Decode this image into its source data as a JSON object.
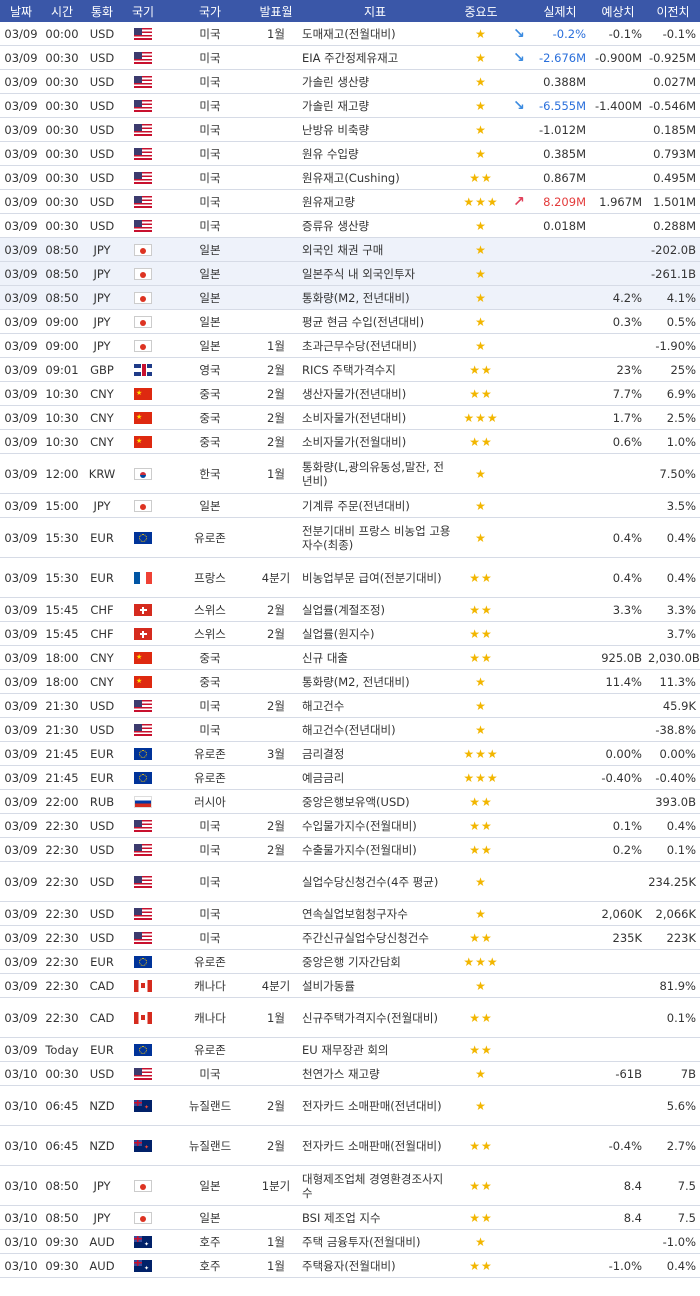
{
  "headers": [
    "날짜",
    "시간",
    "통화",
    "국기",
    "국가",
    "발표월",
    "지표",
    "중요도",
    "",
    "실제치",
    "예상치",
    "이전치"
  ],
  "colors": {
    "header_bg": "#3a57a8",
    "star": "#f2b600",
    "arrow_down": "#3b8be0",
    "arrow_up": "#e0405a",
    "actual_negative": "#2a6fdb",
    "actual_positive": "#e33b3b"
  },
  "rows": [
    {
      "date": "03/09",
      "time": "00:00",
      "cur": "USD",
      "flag": "us",
      "country": "미국",
      "month": "1월",
      "indicator": "도매재고(전월대비)",
      "stars": "★",
      "arrow": "down",
      "actual": "-0.2%",
      "actual_color": "blue",
      "forecast": "-0.1%",
      "previous": "-0.1%"
    },
    {
      "date": "03/09",
      "time": "00:30",
      "cur": "USD",
      "flag": "us",
      "country": "미국",
      "month": "",
      "indicator": "EIA 주간정제유재고",
      "stars": "★",
      "arrow": "down",
      "actual": "-2.676M",
      "actual_color": "blue",
      "forecast": "-0.900M",
      "previous": "-0.925M"
    },
    {
      "date": "03/09",
      "time": "00:30",
      "cur": "USD",
      "flag": "us",
      "country": "미국",
      "month": "",
      "indicator": "가솔린 생산량",
      "stars": "★",
      "arrow": "",
      "actual": "0.388M",
      "actual_color": "",
      "forecast": "",
      "previous": "0.027M"
    },
    {
      "date": "03/09",
      "time": "00:30",
      "cur": "USD",
      "flag": "us",
      "country": "미국",
      "month": "",
      "indicator": "가솔린 재고량",
      "stars": "★",
      "arrow": "down",
      "actual": "-6.555M",
      "actual_color": "blue",
      "forecast": "-1.400M",
      "previous": "-0.546M"
    },
    {
      "date": "03/09",
      "time": "00:30",
      "cur": "USD",
      "flag": "us",
      "country": "미국",
      "month": "",
      "indicator": "난방유 비축량",
      "stars": "★",
      "arrow": "",
      "actual": "-1.012M",
      "actual_color": "",
      "forecast": "",
      "previous": "0.185M"
    },
    {
      "date": "03/09",
      "time": "00:30",
      "cur": "USD",
      "flag": "us",
      "country": "미국",
      "month": "",
      "indicator": "원유 수입량",
      "stars": "★",
      "arrow": "",
      "actual": "0.385M",
      "actual_color": "",
      "forecast": "",
      "previous": "0.793M"
    },
    {
      "date": "03/09",
      "time": "00:30",
      "cur": "USD",
      "flag": "us",
      "country": "미국",
      "month": "",
      "indicator": "원유재고(Cushing)",
      "stars": "★★",
      "arrow": "",
      "actual": "0.867M",
      "actual_color": "",
      "forecast": "",
      "previous": "0.495M"
    },
    {
      "date": "03/09",
      "time": "00:30",
      "cur": "USD",
      "flag": "us",
      "country": "미국",
      "month": "",
      "indicator": "원유재고량",
      "stars": "★★★",
      "arrow": "up",
      "actual": "8.209M",
      "actual_color": "red",
      "forecast": "1.967M",
      "previous": "1.501M"
    },
    {
      "date": "03/09",
      "time": "00:30",
      "cur": "USD",
      "flag": "us",
      "country": "미국",
      "month": "",
      "indicator": "증류유 생산량",
      "stars": "★",
      "arrow": "",
      "actual": "0.018M",
      "actual_color": "",
      "forecast": "",
      "previous": "0.288M"
    },
    {
      "date": "03/09",
      "time": "08:50",
      "cur": "JPY",
      "flag": "jp",
      "country": "일본",
      "month": "",
      "indicator": "외국인 채권 구매",
      "stars": "★",
      "arrow": "",
      "actual": "",
      "actual_color": "",
      "forecast": "",
      "previous": "-202.0B",
      "hl": true
    },
    {
      "date": "03/09",
      "time": "08:50",
      "cur": "JPY",
      "flag": "jp",
      "country": "일본",
      "month": "",
      "indicator": "일본주식 내 외국인투자",
      "stars": "★",
      "arrow": "",
      "actual": "",
      "actual_color": "",
      "forecast": "",
      "previous": "-261.1B",
      "hl": true
    },
    {
      "date": "03/09",
      "time": "08:50",
      "cur": "JPY",
      "flag": "jp",
      "country": "일본",
      "month": "",
      "indicator": "통화량(M2, 전년대비)",
      "stars": "★",
      "arrow": "",
      "actual": "",
      "actual_color": "",
      "forecast": "4.2%",
      "previous": "4.1%",
      "hl": true
    },
    {
      "date": "03/09",
      "time": "09:00",
      "cur": "JPY",
      "flag": "jp",
      "country": "일본",
      "month": "",
      "indicator": "평균 현금 수입(전년대비)",
      "stars": "★",
      "arrow": "",
      "actual": "",
      "actual_color": "",
      "forecast": "0.3%",
      "previous": "0.5%"
    },
    {
      "date": "03/09",
      "time": "09:00",
      "cur": "JPY",
      "flag": "jp",
      "country": "일본",
      "month": "1월",
      "indicator": "초과근무수당(전년대비)",
      "stars": "★",
      "arrow": "",
      "actual": "",
      "actual_color": "",
      "forecast": "",
      "previous": "-1.90%"
    },
    {
      "date": "03/09",
      "time": "09:01",
      "cur": "GBP",
      "flag": "gb",
      "country": "영국",
      "month": "2월",
      "indicator": "RICS 주택가격수지",
      "stars": "★★",
      "arrow": "",
      "actual": "",
      "actual_color": "",
      "forecast": "23%",
      "previous": "25%"
    },
    {
      "date": "03/09",
      "time": "10:30",
      "cur": "CNY",
      "flag": "cn",
      "country": "중국",
      "month": "2월",
      "indicator": "생산자물가(전년대비)",
      "stars": "★★",
      "arrow": "",
      "actual": "",
      "actual_color": "",
      "forecast": "7.7%",
      "previous": "6.9%"
    },
    {
      "date": "03/09",
      "time": "10:30",
      "cur": "CNY",
      "flag": "cn",
      "country": "중국",
      "month": "2월",
      "indicator": "소비자물가(전년대비)",
      "stars": "★★★",
      "arrow": "",
      "actual": "",
      "actual_color": "",
      "forecast": "1.7%",
      "previous": "2.5%"
    },
    {
      "date": "03/09",
      "time": "10:30",
      "cur": "CNY",
      "flag": "cn",
      "country": "중국",
      "month": "2월",
      "indicator": "소비자물가(전월대비)",
      "stars": "★★",
      "arrow": "",
      "actual": "",
      "actual_color": "",
      "forecast": "0.6%",
      "previous": "1.0%"
    },
    {
      "date": "03/09",
      "time": "12:00",
      "cur": "KRW",
      "flag": "kr",
      "country": "한국",
      "month": "1월",
      "indicator": "통화량(L,광의유동성,말잔, 전년비)",
      "stars": "★",
      "arrow": "",
      "actual": "",
      "actual_color": "",
      "forecast": "",
      "previous": "7.50%",
      "tall": true
    },
    {
      "date": "03/09",
      "time": "15:00",
      "cur": "JPY",
      "flag": "jp",
      "country": "일본",
      "month": "",
      "indicator": "기계류 주문(전년대비)",
      "stars": "★",
      "arrow": "",
      "actual": "",
      "actual_color": "",
      "forecast": "",
      "previous": "3.5%"
    },
    {
      "date": "03/09",
      "time": "15:30",
      "cur": "EUR",
      "flag": "eu",
      "country": "유로존",
      "month": "",
      "indicator": "전분기대비 프랑스 비농업 고용자수(최종)",
      "stars": "★",
      "arrow": "",
      "actual": "",
      "actual_color": "",
      "forecast": "0.4%",
      "previous": "0.4%",
      "tall": true
    },
    {
      "date": "03/09",
      "time": "15:30",
      "cur": "EUR",
      "flag": "fr",
      "country": "프랑스",
      "month": "4분기",
      "indicator": "비농업부문 급여(전분기대비)",
      "stars": "★★",
      "arrow": "",
      "actual": "",
      "actual_color": "",
      "forecast": "0.4%",
      "previous": "0.4%",
      "tall": true
    },
    {
      "date": "03/09",
      "time": "15:45",
      "cur": "CHF",
      "flag": "ch",
      "country": "스위스",
      "month": "2월",
      "indicator": "실업률(계절조정)",
      "stars": "★★",
      "arrow": "",
      "actual": "",
      "actual_color": "",
      "forecast": "3.3%",
      "previous": "3.3%"
    },
    {
      "date": "03/09",
      "time": "15:45",
      "cur": "CHF",
      "flag": "ch",
      "country": "스위스",
      "month": "2월",
      "indicator": "실업률(원지수)",
      "stars": "★★",
      "arrow": "",
      "actual": "",
      "actual_color": "",
      "forecast": "",
      "previous": "3.7%"
    },
    {
      "date": "03/09",
      "time": "18:00",
      "cur": "CNY",
      "flag": "cn",
      "country": "중국",
      "month": "",
      "indicator": "신규 대출",
      "stars": "★★",
      "arrow": "",
      "actual": "",
      "actual_color": "",
      "forecast": "925.0B",
      "previous": "2,030.0B"
    },
    {
      "date": "03/09",
      "time": "18:00",
      "cur": "CNY",
      "flag": "cn",
      "country": "중국",
      "month": "",
      "indicator": "통화량(M2, 전년대비)",
      "stars": "★",
      "arrow": "",
      "actual": "",
      "actual_color": "",
      "forecast": "11.4%",
      "previous": "11.3%"
    },
    {
      "date": "03/09",
      "time": "21:30",
      "cur": "USD",
      "flag": "us",
      "country": "미국",
      "month": "2월",
      "indicator": "해고건수",
      "stars": "★",
      "arrow": "",
      "actual": "",
      "actual_color": "",
      "forecast": "",
      "previous": "45.9K"
    },
    {
      "date": "03/09",
      "time": "21:30",
      "cur": "USD",
      "flag": "us",
      "country": "미국",
      "month": "",
      "indicator": "해고건수(전년대비)",
      "stars": "★",
      "arrow": "",
      "actual": "",
      "actual_color": "",
      "forecast": "",
      "previous": "-38.8%"
    },
    {
      "date": "03/09",
      "time": "21:45",
      "cur": "EUR",
      "flag": "eu",
      "country": "유로존",
      "month": "3월",
      "indicator": "금리결정",
      "stars": "★★★",
      "arrow": "",
      "actual": "",
      "actual_color": "",
      "forecast": "0.00%",
      "previous": "0.00%"
    },
    {
      "date": "03/09",
      "time": "21:45",
      "cur": "EUR",
      "flag": "eu",
      "country": "유로존",
      "month": "",
      "indicator": "예금금리",
      "stars": "★★★",
      "arrow": "",
      "actual": "",
      "actual_color": "",
      "forecast": "-0.40%",
      "previous": "-0.40%"
    },
    {
      "date": "03/09",
      "time": "22:00",
      "cur": "RUB",
      "flag": "ru",
      "country": "러시아",
      "month": "",
      "indicator": "중앙은행보유액(USD)",
      "stars": "★★",
      "arrow": "",
      "actual": "",
      "actual_color": "",
      "forecast": "",
      "previous": "393.0B"
    },
    {
      "date": "03/09",
      "time": "22:30",
      "cur": "USD",
      "flag": "us",
      "country": "미국",
      "month": "2월",
      "indicator": "수입물가지수(전월대비)",
      "stars": "★★",
      "arrow": "",
      "actual": "",
      "actual_color": "",
      "forecast": "0.1%",
      "previous": "0.4%"
    },
    {
      "date": "03/09",
      "time": "22:30",
      "cur": "USD",
      "flag": "us",
      "country": "미국",
      "month": "2월",
      "indicator": "수출물가지수(전월대비)",
      "stars": "★★",
      "arrow": "",
      "actual": "",
      "actual_color": "",
      "forecast": "0.2%",
      "previous": "0.1%"
    },
    {
      "date": "03/09",
      "time": "22:30",
      "cur": "USD",
      "flag": "us",
      "country": "미국",
      "month": "",
      "indicator": "실업수당신청건수(4주 평균)",
      "stars": "★",
      "arrow": "",
      "actual": "",
      "actual_color": "",
      "forecast": "",
      "previous": "234.25K",
      "tall": true
    },
    {
      "date": "03/09",
      "time": "22:30",
      "cur": "USD",
      "flag": "us",
      "country": "미국",
      "month": "",
      "indicator": "연속실업보험청구자수",
      "stars": "★",
      "arrow": "",
      "actual": "",
      "actual_color": "",
      "forecast": "2,060K",
      "previous": "2,066K"
    },
    {
      "date": "03/09",
      "time": "22:30",
      "cur": "USD",
      "flag": "us",
      "country": "미국",
      "month": "",
      "indicator": "주간신규실업수당신청건수",
      "stars": "★★",
      "arrow": "",
      "actual": "",
      "actual_color": "",
      "forecast": "235K",
      "previous": "223K"
    },
    {
      "date": "03/09",
      "time": "22:30",
      "cur": "EUR",
      "flag": "eu",
      "country": "유로존",
      "month": "",
      "indicator": "중앙은행 기자간담회",
      "stars": "★★★",
      "arrow": "",
      "actual": "",
      "actual_color": "",
      "forecast": "",
      "previous": ""
    },
    {
      "date": "03/09",
      "time": "22:30",
      "cur": "CAD",
      "flag": "ca",
      "country": "캐나다",
      "month": "4분기",
      "indicator": "설비가동률",
      "stars": "★",
      "arrow": "",
      "actual": "",
      "actual_color": "",
      "forecast": "",
      "previous": "81.9%"
    },
    {
      "date": "03/09",
      "time": "22:30",
      "cur": "CAD",
      "flag": "ca",
      "country": "캐나다",
      "month": "1월",
      "indicator": "신규주택가격지수(전월대비)",
      "stars": "★★",
      "arrow": "",
      "actual": "",
      "actual_color": "",
      "forecast": "",
      "previous": "0.1%",
      "tall": true
    },
    {
      "date": "03/09",
      "time": "Today",
      "cur": "EUR",
      "flag": "eu",
      "country": "유로존",
      "month": "",
      "indicator": "EU 재무장관 회의",
      "stars": "★★",
      "arrow": "",
      "actual": "",
      "actual_color": "",
      "forecast": "",
      "previous": ""
    },
    {
      "date": "03/10",
      "time": "00:30",
      "cur": "USD",
      "flag": "us",
      "country": "미국",
      "month": "",
      "indicator": "천연가스 재고량",
      "stars": "★",
      "arrow": "",
      "actual": "",
      "actual_color": "",
      "forecast": "-61B",
      "previous": "7B"
    },
    {
      "date": "03/10",
      "time": "06:45",
      "cur": "NZD",
      "flag": "nz",
      "country": "뉴질랜드",
      "month": "2월",
      "indicator": "전자카드 소매판매(전년대비)",
      "stars": "★",
      "arrow": "",
      "actual": "",
      "actual_color": "",
      "forecast": "",
      "previous": "5.6%",
      "tall": true
    },
    {
      "date": "03/10",
      "time": "06:45",
      "cur": "NZD",
      "flag": "nz",
      "country": "뉴질랜드",
      "month": "2월",
      "indicator": "전자카드 소매판매(전월대비)",
      "stars": "★★",
      "arrow": "",
      "actual": "",
      "actual_color": "",
      "forecast": "-0.4%",
      "previous": "2.7%",
      "tall": true
    },
    {
      "date": "03/10",
      "time": "08:50",
      "cur": "JPY",
      "flag": "jp",
      "country": "일본",
      "month": "1분기",
      "indicator": "대형제조업체 경영환경조사지수",
      "stars": "★★",
      "arrow": "",
      "actual": "",
      "actual_color": "",
      "forecast": "8.4",
      "previous": "7.5",
      "tall": true
    },
    {
      "date": "03/10",
      "time": "08:50",
      "cur": "JPY",
      "flag": "jp",
      "country": "일본",
      "month": "",
      "indicator": "BSI 제조업 지수",
      "stars": "★★",
      "arrow": "",
      "actual": "",
      "actual_color": "",
      "forecast": "8.4",
      "previous": "7.5"
    },
    {
      "date": "03/10",
      "time": "09:30",
      "cur": "AUD",
      "flag": "au",
      "country": "호주",
      "month": "1월",
      "indicator": "주택 금융투자(전월대비)",
      "stars": "★",
      "arrow": "",
      "actual": "",
      "actual_color": "",
      "forecast": "",
      "previous": "-1.0%"
    },
    {
      "date": "03/10",
      "time": "09:30",
      "cur": "AUD",
      "flag": "au",
      "country": "호주",
      "month": "1월",
      "indicator": "주택융자(전월대비)",
      "stars": "★★",
      "arrow": "",
      "actual": "",
      "actual_color": "",
      "forecast": "-1.0%",
      "previous": "0.4%"
    }
  ]
}
